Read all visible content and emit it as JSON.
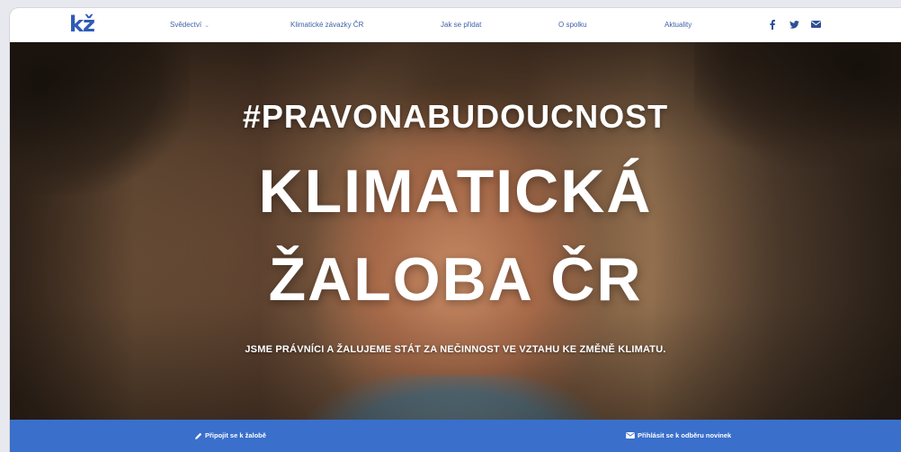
{
  "logo": {
    "text": "kž"
  },
  "nav": {
    "items": [
      {
        "label": "Svědectví",
        "has_dropdown": true
      },
      {
        "label": "Klimatické závazky ČR"
      },
      {
        "label": "Jak se přidat"
      },
      {
        "label": "O spolku"
      },
      {
        "label": "Aktuality"
      }
    ],
    "social": [
      "facebook-icon",
      "twitter-icon",
      "mail-icon"
    ]
  },
  "hero": {
    "hashtag": "#PRAVONABUDOUCNOST",
    "title_line1": "KLIMATICKÁ",
    "title_line2": "ŽALOBA ČR",
    "subtitle": "JSME PRÁVNÍCI A ŽALUJEME STÁT ZA NEČINNOST VE VZTAHU KE ZMĚNĚ KLIMATU."
  },
  "bottom_bar": {
    "join_label": "Připojit se k žalobě",
    "subscribe_label": "Přihlásit se k odběru novinek"
  },
  "colors": {
    "brand_blue": "#2f5bb6",
    "nav_text": "#3f62a8",
    "bar_blue": "#3a6fcb"
  }
}
